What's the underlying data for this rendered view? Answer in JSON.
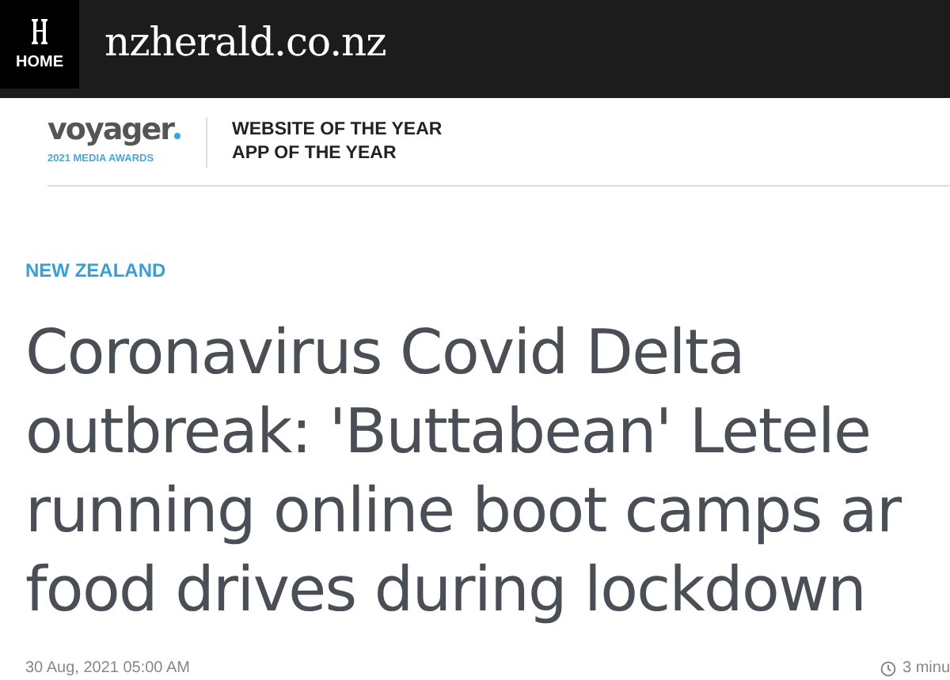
{
  "header": {
    "logo_label": "HOME",
    "site_name": "nzherald.co.nz"
  },
  "awards": {
    "brand": "voyager",
    "brand_sub": "2021 MEDIA AWARDS",
    "lines": [
      "WEBSITE OF THE YEAR",
      "APP OF THE YEAR"
    ]
  },
  "article": {
    "section": "NEW ZEALAND",
    "headline_lines": [
      "Coronavirus Covid Delta",
      "outbreak: 'Buttabean' Letele",
      "running online boot camps ar",
      "food drives during lockdown"
    ],
    "date": "30 Aug, 2021 05:00 AM",
    "read_time": "3 minu"
  }
}
